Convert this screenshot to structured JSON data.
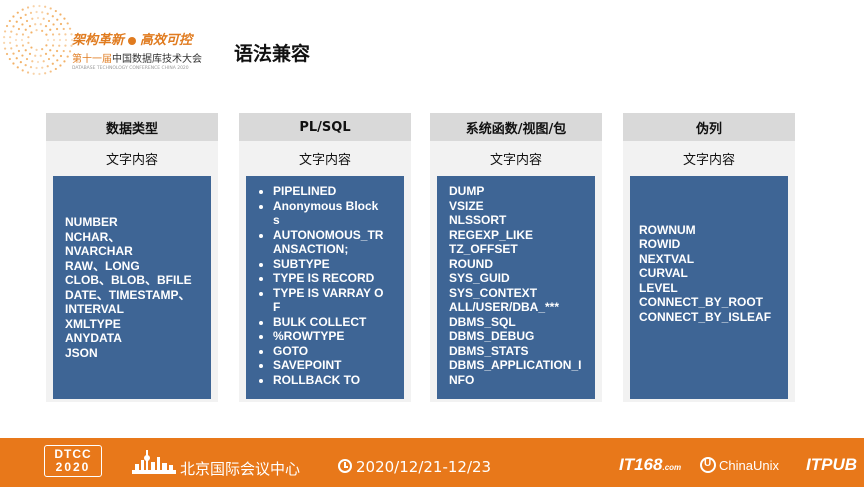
{
  "header": {
    "logo_line1_a": "架构革新",
    "logo_line1_b": "高效可控",
    "logo_line2_a": "第十一届",
    "logo_line2_b": "中国数据库技术大会",
    "logo_line3": "DATABASE TECHNOLOGY CONFERENCE CHINA 2020",
    "title": "语法兼容"
  },
  "columns": [
    {
      "header": "数据类型",
      "subtitle": "文字内容",
      "items": [
        "NUMBER",
        "NCHAR、",
        "NVARCHAR",
        "RAW、LONG",
        "CLOB、BLOB、BFILE",
        "DATE、TIMESTAMP、",
        "INTERVAL",
        "XMLTYPE",
        "ANYDATA",
        "JSON"
      ]
    },
    {
      "header": "PL/SQL",
      "subtitle": "文字内容",
      "items": [
        "PIPELINED",
        "Anonymous Blocks",
        "AUTONOMOUS_TRANSACTION;",
        "SUBTYPE",
        "TYPE IS RECORD",
        "TYPE IS VARRAY OF",
        "BULK COLLECT",
        "%ROWTYPE",
        "GOTO",
        "SAVEPOINT",
        "ROLLBACK TO"
      ]
    },
    {
      "header": "系统函数/视图/包",
      "subtitle": "文字内容",
      "items": [
        "DUMP",
        "VSIZE",
        "NLSSORT",
        "REGEXP_LIKE",
        "TZ_OFFSET",
        "ROUND",
        "SYS_GUID",
        "SYS_CONTEXT",
        "ALL/USER/DBA_***",
        "DBMS_SQL",
        "DBMS_DEBUG",
        "DBMS_STATS",
        "DBMS_APPLICATION_INFO"
      ]
    },
    {
      "header": "伪列",
      "subtitle": "文字内容",
      "items": [
        "ROWNUM",
        "ROWID",
        "NEXTVAL",
        "CURVAL",
        "LEVEL",
        "CONNECT_BY_ROOT",
        "CONNECT_BY_ISLEAF"
      ]
    }
  ],
  "footer": {
    "dtcc_line1": "DTCC",
    "dtcc_line2": "2020",
    "venue": "北京国际会议中心",
    "date": "2020/12/21-12/23",
    "logo_it168": "IT168",
    "logo_it168_suffix": ".com",
    "logo_chinaunix": "ChinaUnix",
    "logo_itpub": "ITPUB"
  },
  "colors": {
    "accent_orange": "#e8781a",
    "box_blue": "#3e6595",
    "header_gray": "#d9d9d9",
    "panel_gray": "#f2f2f2"
  }
}
